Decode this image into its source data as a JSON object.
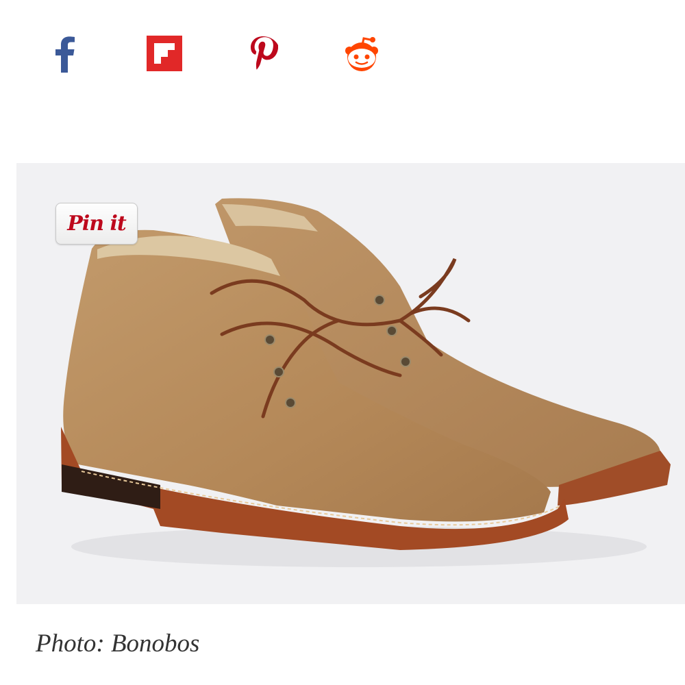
{
  "share": {
    "items": [
      {
        "network": "Facebook",
        "icon": "facebook-icon",
        "color": "#3b5998"
      },
      {
        "network": "Flipboard",
        "icon": "flipboard-icon",
        "color": "#e12828"
      },
      {
        "network": "Pinterest",
        "icon": "pinterest-icon",
        "color": "#bd081c"
      },
      {
        "network": "Reddit",
        "icon": "reddit-icon",
        "color": "#ff4500"
      }
    ]
  },
  "photo": {
    "pin_button_label": "Pin it",
    "background_color": "#f1f1f3",
    "subject": "boots-image"
  },
  "caption": "Photo: Bonobos"
}
